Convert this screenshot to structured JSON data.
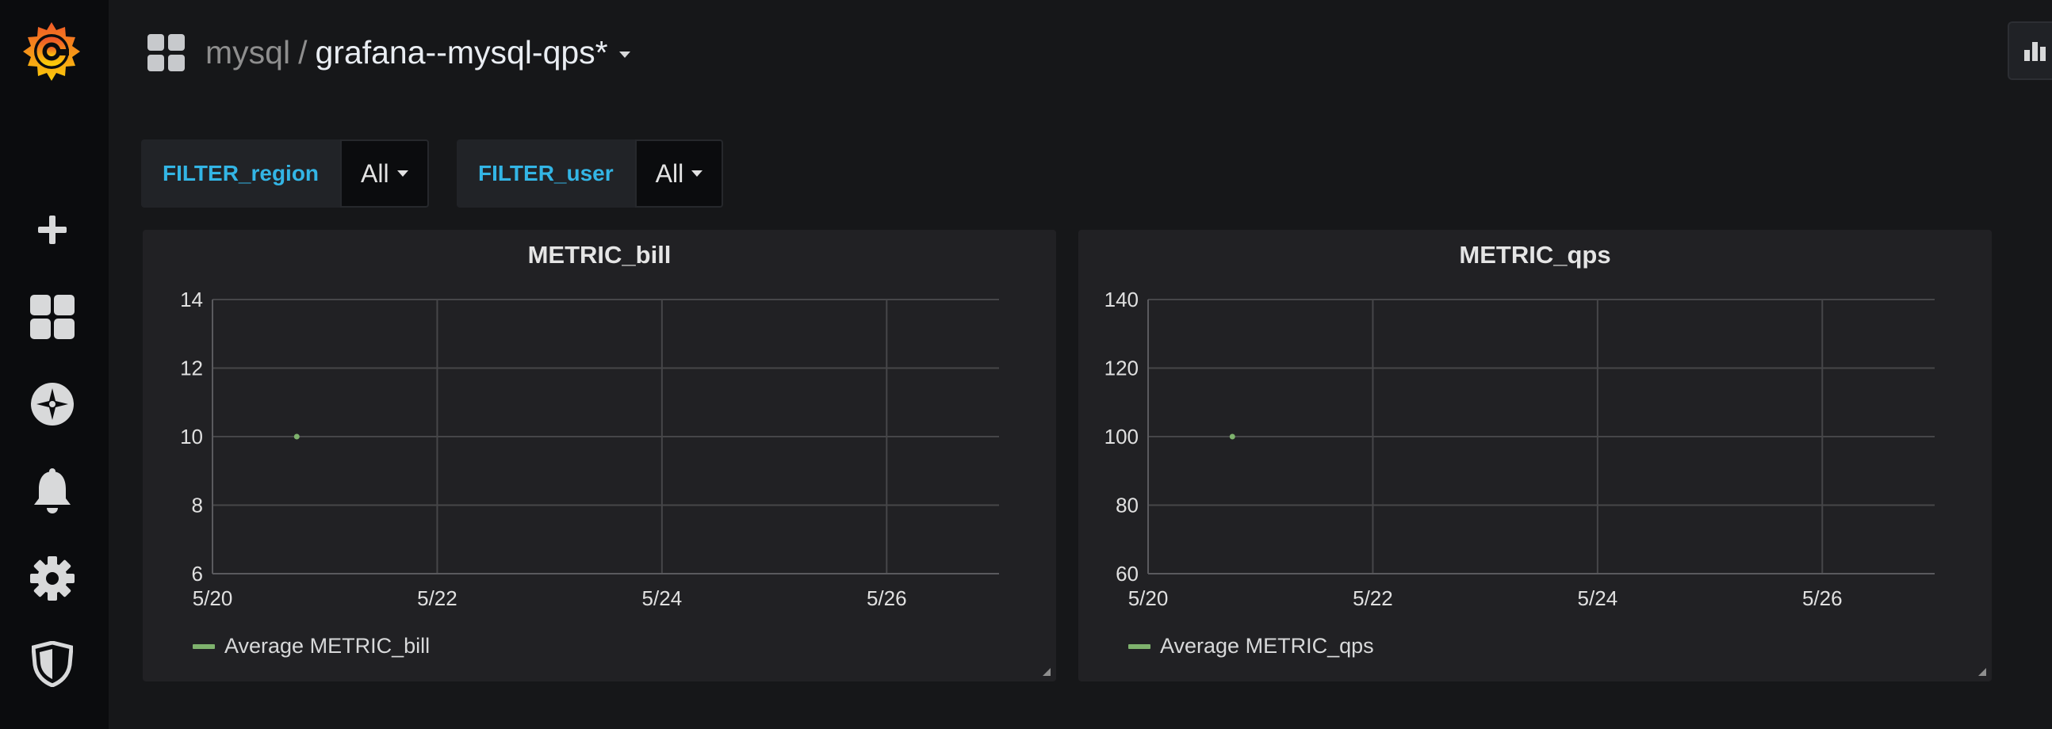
{
  "breadcrumb": {
    "folder": "mysql",
    "separator": "/",
    "title": "grafana--mysql-qps*"
  },
  "sidebar": {
    "items": [
      {
        "name": "create",
        "icon": "plus-icon"
      },
      {
        "name": "dashboards",
        "icon": "dashboards-icon"
      },
      {
        "name": "explore",
        "icon": "compass-icon"
      },
      {
        "name": "alerting",
        "icon": "bell-icon"
      },
      {
        "name": "configuration",
        "icon": "gear-icon"
      },
      {
        "name": "server-admin",
        "icon": "shield-icon"
      }
    ]
  },
  "variables": [
    {
      "label": "FILTER_region",
      "value": "All"
    },
    {
      "label": "FILTER_user",
      "value": "All"
    }
  ],
  "colors": {
    "accent": "#33b5e5",
    "series": "#7eb26d",
    "panel_bg": "#212124",
    "page_bg": "#161719"
  },
  "chart_data": [
    {
      "type": "scatter",
      "title": "METRIC_bill",
      "xlabel": "",
      "ylabel": "",
      "x_ticks": [
        "5/20",
        "5/22",
        "5/24",
        "5/26"
      ],
      "y_ticks": [
        6,
        8,
        10,
        12,
        14
      ],
      "ylim": [
        6,
        14
      ],
      "xlim": [
        "5/20",
        "5/27"
      ],
      "grid": true,
      "legend": "bottom-left",
      "series": [
        {
          "name": "Average METRIC_bill",
          "x": [
            "5/20 18:00"
          ],
          "y": [
            10
          ]
        }
      ]
    },
    {
      "type": "scatter",
      "title": "METRIC_qps",
      "xlabel": "",
      "ylabel": "",
      "x_ticks": [
        "5/20",
        "5/22",
        "5/24",
        "5/26"
      ],
      "y_ticks": [
        60,
        80,
        100,
        120,
        140
      ],
      "ylim": [
        60,
        140
      ],
      "xlim": [
        "5/20",
        "5/27"
      ],
      "grid": true,
      "legend": "bottom-left",
      "series": [
        {
          "name": "Average METRIC_qps",
          "x": [
            "5/20 18:00"
          ],
          "y": [
            100
          ]
        }
      ]
    }
  ]
}
